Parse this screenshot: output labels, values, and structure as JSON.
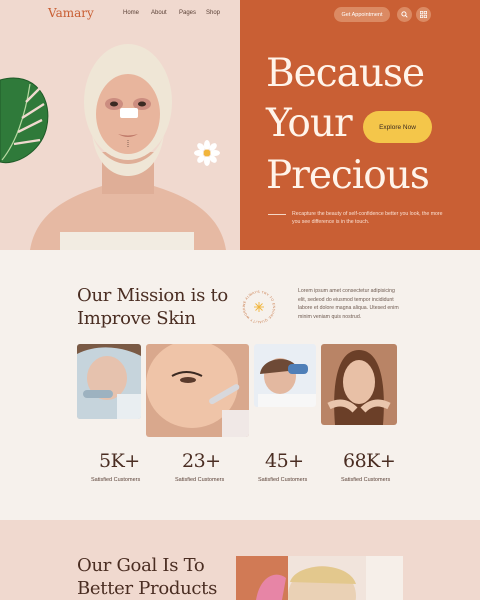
{
  "brand": {
    "logo": "Vamary",
    "accent": "#c95f34"
  },
  "nav": {
    "items": [
      "Home",
      "About",
      "Pages",
      "Shop"
    ]
  },
  "header_actions": {
    "appointment_label": "Get Appointment",
    "icons": [
      "search-icon",
      "grid-icon"
    ]
  },
  "hero": {
    "headline_lines": [
      "Because",
      "Your",
      "Precious"
    ],
    "explore_label": "Explore Now",
    "description": "Recapture the beauty of self-confidence better you look, the more you see difference is in the touch."
  },
  "mission": {
    "title_lines": [
      "Our Mission is to",
      "Improve Skin"
    ],
    "badge_text": "WE ALWAYS TRY TO ENSURE QUALITY WORK",
    "description": "Lorem ipsum amet consectetur adipisicing elit, sedeod do eiusmod tempor incididunt labore et dolore magna aliqua. Utesed enim minim veniam quis nostrud."
  },
  "stats": [
    {
      "value": "5K+",
      "label": "Satisfied Customers"
    },
    {
      "value": "23+",
      "label": "Satisfied Customers"
    },
    {
      "value": "45+",
      "label": "Satisfied Customers"
    },
    {
      "value": "68K+",
      "label": "Satisfied Customers"
    }
  ],
  "goal": {
    "title_lines": [
      "Our Goal Is To",
      "Better Products"
    ]
  }
}
